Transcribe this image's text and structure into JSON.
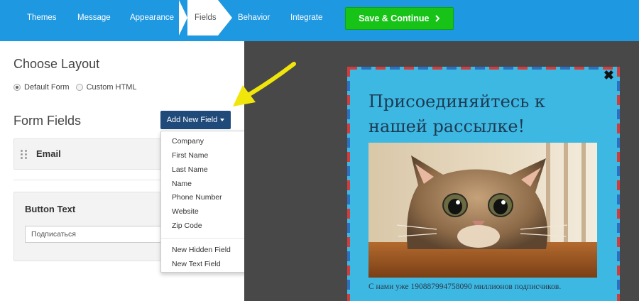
{
  "nav": {
    "tabs": [
      "Themes",
      "Message",
      "Appearance",
      "Fields",
      "Behavior",
      "Integrate"
    ],
    "active_tab": "Fields",
    "save_label": "Save & Continue",
    "save_icon": "chevron-right-icon",
    "colors": {
      "bar": "#1e98e1",
      "save": "#18c318"
    }
  },
  "layout": {
    "title": "Choose Layout",
    "options": [
      "Default Form",
      "Custom HTML"
    ],
    "selected": "Default Form"
  },
  "form_fields": {
    "title": "Form Fields",
    "add_button_label": "Add New Field",
    "fields": [
      "Email"
    ],
    "dropdown": {
      "standard": [
        "Company",
        "First Name",
        "Last Name",
        "Name",
        "Phone Number",
        "Website",
        "Zip Code"
      ],
      "custom": [
        "New Hidden Field",
        "New Text Field"
      ]
    }
  },
  "button_text": {
    "title": "Button Text",
    "value": "Подписаться"
  },
  "preview": {
    "close_glyph": "✖",
    "title": "Присоединяйтесь к нашей рассылке!",
    "image": "cat-photo",
    "footer": "С нами уже 190887994758090 миллионов подписчиков.",
    "colors": {
      "background": "#484848",
      "popup": "#3db8e2",
      "title": "#1e3a52"
    }
  }
}
